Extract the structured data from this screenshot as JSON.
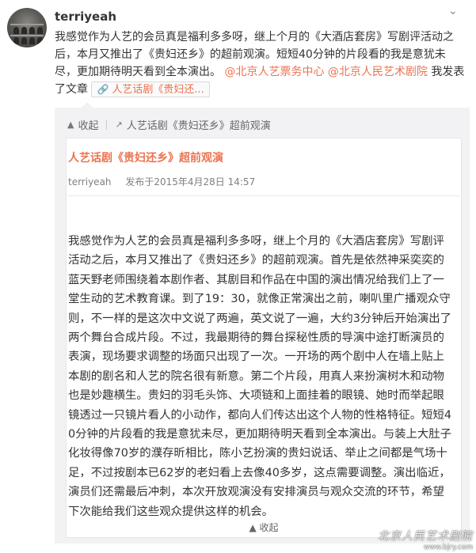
{
  "post": {
    "username": "terriyeah",
    "text_part1": "我感觉作为人艺的会员真是福利多多呀，继上个月的《大酒店套房》写剧评活动之后，本月又推出了《贵妇还乡》的超前观演。短短40分钟的片段看的我是意犹未尽，更加期待明天看到全本演出。",
    "mention1": "@北京人艺票务中心",
    "mention2": "@北京人民艺术剧院",
    "text_part2": "我发表了文章",
    "link_chip": "人艺话剧《贵妇还..."
  },
  "repost": {
    "collapse_label": "收起",
    "article_link_label": "人艺话剧《贵妇还乡》超前观演",
    "article": {
      "title": "人艺话剧《贵妇还乡》超前观演",
      "author": "terriyeah",
      "published": "发布于2015年4月28日 14:57",
      "body": "我感觉作为人艺的会员真是福利多多呀，继上个月的《大酒店套房》写剧评活动之后，本月又推出了《贵妇还乡》的超前观演。首先是依然神采奕奕的蓝天野老师围绕着本剧作者、其剧目和作品在中国的演出情况给我们上了一堂生动的艺术教育课。到了19：30，就像正常演出之前，喇叭里广播观众守则，不一样的是这次中文说了两遍，英文说了一遍，大约3分钟后开始演出了两个舞台合成片段。不过，我最期待的舞台探秘性质的导演中途打断演员的表演，现场要求调整的场面只出现了一次。一开场的两个剧中人在墙上贴上本剧的剧名和人艺的院名很有新意。第二个片段，用真人来扮演树木和动物也是妙趣横生。贵妇的羽毛头饰、大项链和上面挂着的眼镜、她时而举起眼镜透过一只镜片看人的小动作，都向人们传达出这个人物的性格特征。短短40分钟的片段看的我是意犹未尽，更加期待明天看到全本演出。与装上大肚子化妆得像70岁的濮存昕相比，陈小艺扮演的贵妇说话、举止之间都是气场十足，不过按剧本已62岁的老妇看上去像40多岁，这点需要调整。演出临近，演员们还需最后冲刺，本次开放观演没有安排演员与观众交流的环节，希望下次能给我们这些观众提供这样的机会。"
    },
    "collapse_bottom_label": "收起"
  },
  "watermark": {
    "name": "北京人民艺术剧院",
    "url": "www.bjry.com"
  },
  "icons": {
    "chevron": "chevron-down-icon",
    "collapse": "collapse-up-icon",
    "external": "external-link-icon",
    "link": "link-icon"
  },
  "colors": {
    "accent": "#eb7350",
    "repost_bg": "#f2f2f5",
    "text": "#333333"
  }
}
